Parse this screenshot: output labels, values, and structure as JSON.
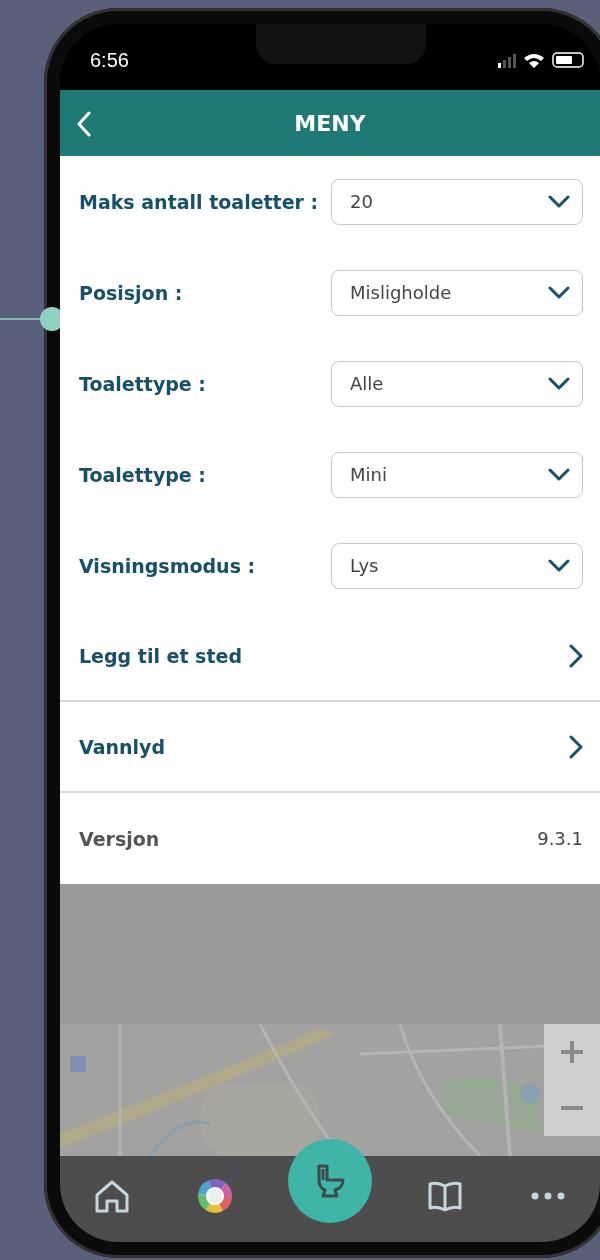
{
  "status_bar": {
    "time": "6:56"
  },
  "header": {
    "title": "MENY"
  },
  "settings": [
    {
      "kind": "dropdown",
      "label": "Maks antall toaletter :",
      "value": "20"
    },
    {
      "kind": "dropdown",
      "label": "Posisjon :",
      "value": "Misligholde"
    },
    {
      "kind": "dropdown",
      "label": "Toalettype :",
      "value": "Alle"
    },
    {
      "kind": "dropdown",
      "label": "Toalettype :",
      "value": "Mini"
    },
    {
      "kind": "dropdown",
      "label": "Visningsmodus :",
      "value": "Lys"
    },
    {
      "kind": "link",
      "label": "Legg til et sted"
    },
    {
      "kind": "link",
      "label": "Vannlyd"
    },
    {
      "kind": "info",
      "label": "Versjon",
      "value": "9.3.1"
    }
  ]
}
